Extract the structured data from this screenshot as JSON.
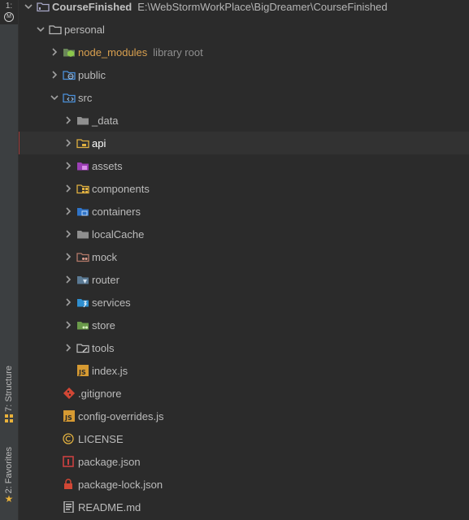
{
  "tool_windows": {
    "project": {
      "number": "1:",
      "icon": "project-m-icon"
    },
    "structure": {
      "label": "7: Structure"
    },
    "favorites": {
      "label": "2: Favorites"
    }
  },
  "root": {
    "name": "CourseFinished",
    "path": "E:\\WebStormWorkPlace\\BigDreamer\\CourseFinished"
  },
  "tree": {
    "personal": "personal",
    "node_modules": {
      "name": "node_modules",
      "hint": "library root"
    },
    "public": "public",
    "src": "src",
    "data": "_data",
    "api": "api",
    "assets": "assets",
    "components": "components",
    "containers": "containers",
    "localCache": "localCache",
    "mock": "mock",
    "router": "router",
    "services": "services",
    "store": "store",
    "tools": "tools",
    "indexjs": "index.js",
    "gitignore": ".gitignore",
    "config_overrides": "config-overrides.js",
    "license": "LICENSE",
    "package_json": "package.json",
    "package_lock": "package-lock.json",
    "readme": "README.md"
  },
  "colors": {
    "background": "#2b2b2b",
    "selected_row": "#323232",
    "excluded_folder": "#d9a04f",
    "js_icon": "#d69a32",
    "git_icon": "#d24735"
  }
}
